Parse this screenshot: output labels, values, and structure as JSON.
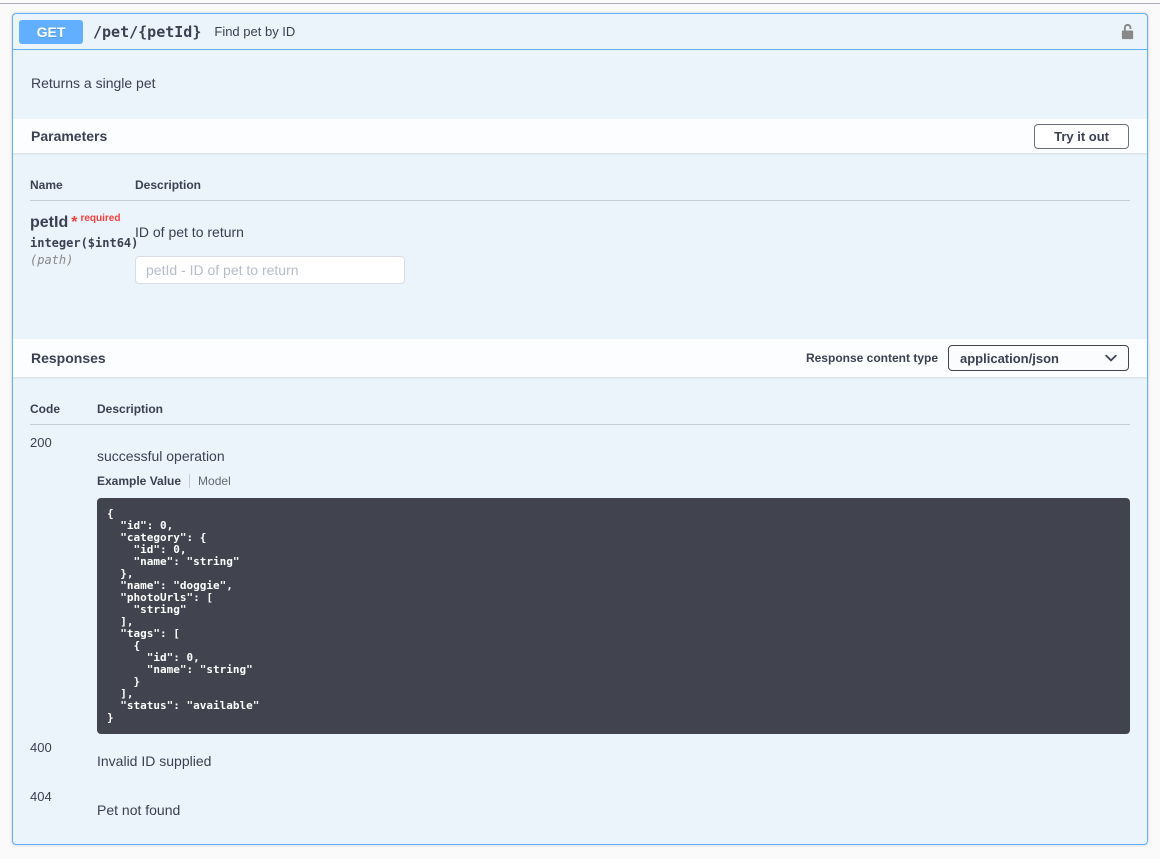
{
  "endpoint": {
    "method": "GET",
    "path": "/pet/{petId}",
    "summary": "Find pet by ID",
    "description": "Returns a single pet"
  },
  "parameters": {
    "section_title": "Parameters",
    "try_it_out": "Try it out",
    "col_name": "Name",
    "col_description": "Description",
    "rows": [
      {
        "name": "petId",
        "required_star": "*",
        "required_label": "required",
        "type": "integer($int64)",
        "located_in": "(path)",
        "description": "ID of pet to return",
        "placeholder": "petId - ID of pet to return",
        "value": ""
      }
    ]
  },
  "responses": {
    "section_title": "Responses",
    "content_type_label": "Response content type",
    "content_type_selected": "application/json",
    "col_code": "Code",
    "col_description": "Description",
    "rows": [
      {
        "code": "200",
        "description": "successful operation",
        "example_tab": "Example Value",
        "model_tab": "Model",
        "example_json": "{\n  \"id\": 0,\n  \"category\": {\n    \"id\": 0,\n    \"name\": \"string\"\n  },\n  \"name\": \"doggie\",\n  \"photoUrls\": [\n    \"string\"\n  ],\n  \"tags\": [\n    {\n      \"id\": 0,\n      \"name\": \"string\"\n    }\n  ],\n  \"status\": \"available\"\n}"
      },
      {
        "code": "400",
        "description": "Invalid ID supplied"
      },
      {
        "code": "404",
        "description": "Pet not found"
      }
    ]
  },
  "colors": {
    "method_blue": "#61affe",
    "panel_bg": "#ebf3fb",
    "code_block_bg": "#41444e",
    "required_red": "#f93e3e",
    "text": "#3b4151"
  }
}
